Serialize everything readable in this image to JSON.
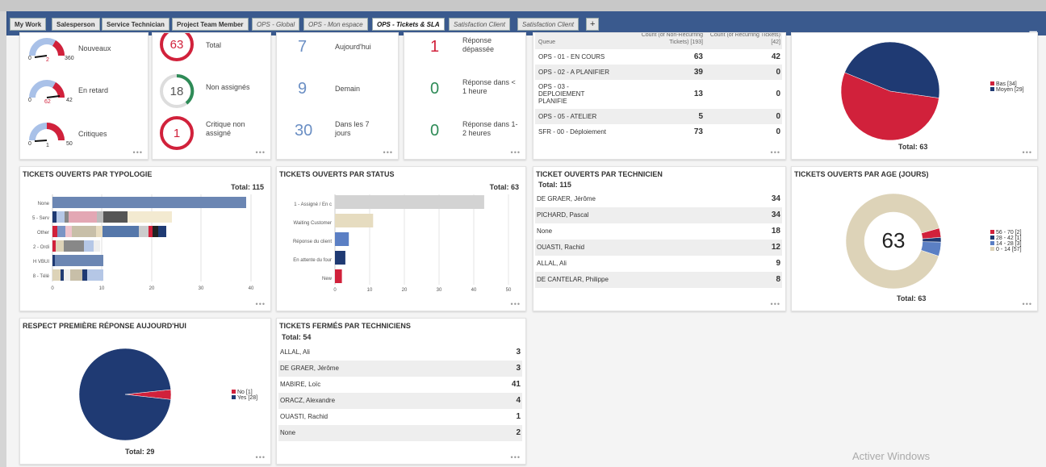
{
  "tabs": [
    {
      "label": "My Work"
    },
    {
      "label": "Salesperson"
    },
    {
      "label": "Service Technician"
    },
    {
      "label": "Project Team Member"
    },
    {
      "label": "OPS - Global"
    },
    {
      "label": "OPS - Mon espace"
    },
    {
      "label": "OPS - Tickets & SLA"
    },
    {
      "label": "Satisfaction Client"
    },
    {
      "label": "Satisfaction Client"
    },
    {
      "label": "+"
    }
  ],
  "gauges": {
    "items": [
      {
        "label": "Nouveaux",
        "min": "0",
        "value": "2",
        "max": "360"
      },
      {
        "label": "En retard",
        "min": "0",
        "value": "62",
        "max": "42"
      },
      {
        "label": "Critiques",
        "min": "0",
        "value": "1",
        "max": "50"
      }
    ]
  },
  "rings": {
    "items": [
      {
        "value": "63",
        "label": "Total"
      },
      {
        "value": "18",
        "label": "Non assignés"
      },
      {
        "value": "1",
        "label": "Critique non assigné"
      }
    ]
  },
  "due": {
    "items": [
      {
        "value": "7",
        "label": "Aujourd'hui"
      },
      {
        "value": "9",
        "label": "Demain"
      },
      {
        "value": "30",
        "label": "Dans les 7 jours"
      }
    ]
  },
  "sla": {
    "items": [
      {
        "value": "1",
        "label": "Réponse dépassée"
      },
      {
        "value": "0",
        "label": "Réponse dans < 1 heure"
      },
      {
        "value": "0",
        "label": "Réponse dans 1-2 heures"
      }
    ]
  },
  "queue": {
    "headers": [
      "Queue",
      "Count (of Non-Recurring Tickets) [193]",
      "Count (of Recurring Tickets) [42]"
    ],
    "rows": [
      {
        "name": "OPS - 01 - EN COURS",
        "a": "63",
        "b": "42"
      },
      {
        "name": "OPS - 02 - A PLANIFIER",
        "a": "39",
        "b": "0"
      },
      {
        "name": "OPS - 03 - DEPLOIEMENT PLANIFIE",
        "a": "13",
        "b": "0"
      },
      {
        "name": "OPS - 05 - ATELIER",
        "a": "5",
        "b": "0"
      },
      {
        "name": "SFR - 00 - Déploiement",
        "a": "73",
        "b": "0"
      }
    ]
  },
  "priority_pie": {
    "total_label": "Total:",
    "total": "63",
    "legend": [
      {
        "label": "Bas [34]",
        "color": "#d1213b"
      },
      {
        "label": "Moyen [29]",
        "color": "#1f3a73"
      }
    ]
  },
  "typologie": {
    "title": "TICKETS OUVERTS PAR TYPOLOGIE",
    "total_label": "Total:",
    "total": "115",
    "categories": [
      "None",
      "5 - Serv",
      "Other",
      "2 - Ordi",
      "H VBUI",
      "8 - Télé"
    ],
    "ticks": [
      "0",
      "10",
      "20",
      "30",
      "40"
    ]
  },
  "status": {
    "title": "TICKETS OUVERTS PAR STATUS",
    "total_label": "Total:",
    "total": "63",
    "categories": [
      "1 - Assigné / En c",
      "Waiting Customer",
      "Réponse du client",
      "En attente du four",
      "New"
    ],
    "ticks": [
      "0",
      "10",
      "20",
      "30",
      "40",
      "50"
    ]
  },
  "technicien": {
    "title": "TICKET OUVERTS PAR TECHNICIEN",
    "total_label": "Total:",
    "total": "115",
    "rows": [
      {
        "name": "DE GRAER, Jérôme",
        "value": "34"
      },
      {
        "name": "PICHARD, Pascal",
        "value": "34"
      },
      {
        "name": "None",
        "value": "18"
      },
      {
        "name": "OUASTI, Rachid",
        "value": "12"
      },
      {
        "name": "ALLAL, Ali",
        "value": "9"
      },
      {
        "name": "DE CANTELAR, Philippe",
        "value": "8"
      }
    ]
  },
  "age": {
    "title": "TICKETS OUVERTS PAR AGE (JOURS)",
    "center": "63",
    "total_label": "Total:",
    "total": "63",
    "legend": [
      {
        "label": "56 - 70 [2]",
        "color": "#d1213b"
      },
      {
        "label": "28 - 42 [1]",
        "color": "#1f3a73"
      },
      {
        "label": "14 - 28 [3]",
        "color": "#5b7fc4"
      },
      {
        "label": "0 - 14 [57]",
        "color": "#ddd3b8"
      }
    ]
  },
  "respect": {
    "title": "RESPECT PREMIÈRE RÉPONSE AUJOURD'HUI",
    "total_label": "Total:",
    "total": "29",
    "legend": [
      {
        "label": "No [1]",
        "color": "#d1213b"
      },
      {
        "label": "Yes [28]",
        "color": "#1f3a73"
      }
    ]
  },
  "fermes": {
    "title": "TICKETS FERMÉS PAR TECHNICIENS",
    "total_label": "Total:",
    "total": "54",
    "rows": [
      {
        "name": "ALLAL, Ali",
        "value": "3"
      },
      {
        "name": "DE GRAER, Jérôme",
        "value": "3"
      },
      {
        "name": "MABIRE, Loïc",
        "value": "41"
      },
      {
        "name": "ORACZ, Alexandre",
        "value": "4"
      },
      {
        "name": "OUASTI, Rachid",
        "value": "1"
      },
      {
        "name": "None",
        "value": "2"
      }
    ]
  },
  "watermark": "Activer Windows",
  "chart_data": [
    {
      "type": "bar",
      "title": "TICKETS OUVERTS PAR STATUS",
      "categories": [
        "1 - Assigné / En c",
        "Waiting Customer",
        "Réponse du client",
        "En attente du four",
        "New"
      ],
      "values": [
        43,
        11,
        4,
        3,
        2
      ],
      "xlim": [
        0,
        50
      ]
    },
    {
      "type": "bar",
      "title": "TICKETS OUVERTS PAR TYPOLOGIE",
      "categories": [
        "None",
        "5 - Serv",
        "Other",
        "2 - Ordi",
        "H VBUI",
        "8 - Télé"
      ],
      "values": [
        39,
        24,
        23,
        10,
        10,
        10
      ],
      "xlim": [
        0,
        40
      ]
    },
    {
      "type": "pie",
      "title": "",
      "series": [
        {
          "name": "Bas",
          "value": 34
        },
        {
          "name": "Moyen",
          "value": 29
        }
      ]
    },
    {
      "type": "pie",
      "title": "TICKETS OUVERTS PAR AGE (JOURS)",
      "series": [
        {
          "name": "56 - 70",
          "value": 2
        },
        {
          "name": "28 - 42",
          "value": 1
        },
        {
          "name": "14 - 28",
          "value": 3
        },
        {
          "name": "0 - 14",
          "value": 57
        }
      ]
    },
    {
      "type": "pie",
      "title": "RESPECT PREMIÈRE RÉPONSE AUJOURD'HUI",
      "series": [
        {
          "name": "No",
          "value": 1
        },
        {
          "name": "Yes",
          "value": 28
        }
      ]
    }
  ]
}
